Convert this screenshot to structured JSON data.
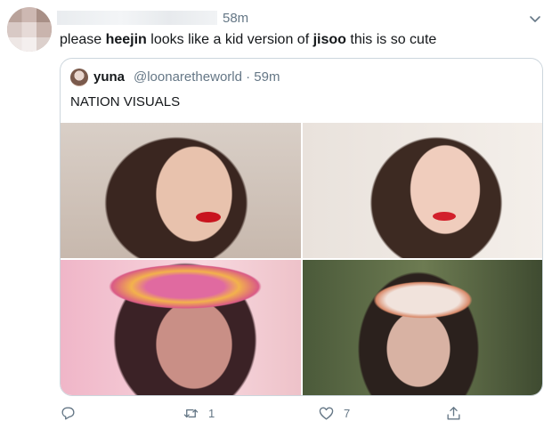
{
  "tweet": {
    "timestamp": "58m",
    "text_parts": [
      "please ",
      "heejin",
      " looks like a kid version of ",
      "jisoo",
      " this is so cute"
    ]
  },
  "quoted_tweet": {
    "name": "yuna",
    "handle": "@loonaretheworld · 59m",
    "text": "NATION VISUALS"
  },
  "actions": {
    "retweet_count": "1",
    "like_count": "7"
  },
  "icons": {
    "menu": "chevron-down-icon",
    "reply": "reply-icon",
    "retweet": "retweet-icon",
    "like": "heart-icon",
    "share": "share-icon"
  },
  "colors": {
    "text_primary": "#14171a",
    "text_secondary": "#657786",
    "border": "#ccd6dd"
  }
}
